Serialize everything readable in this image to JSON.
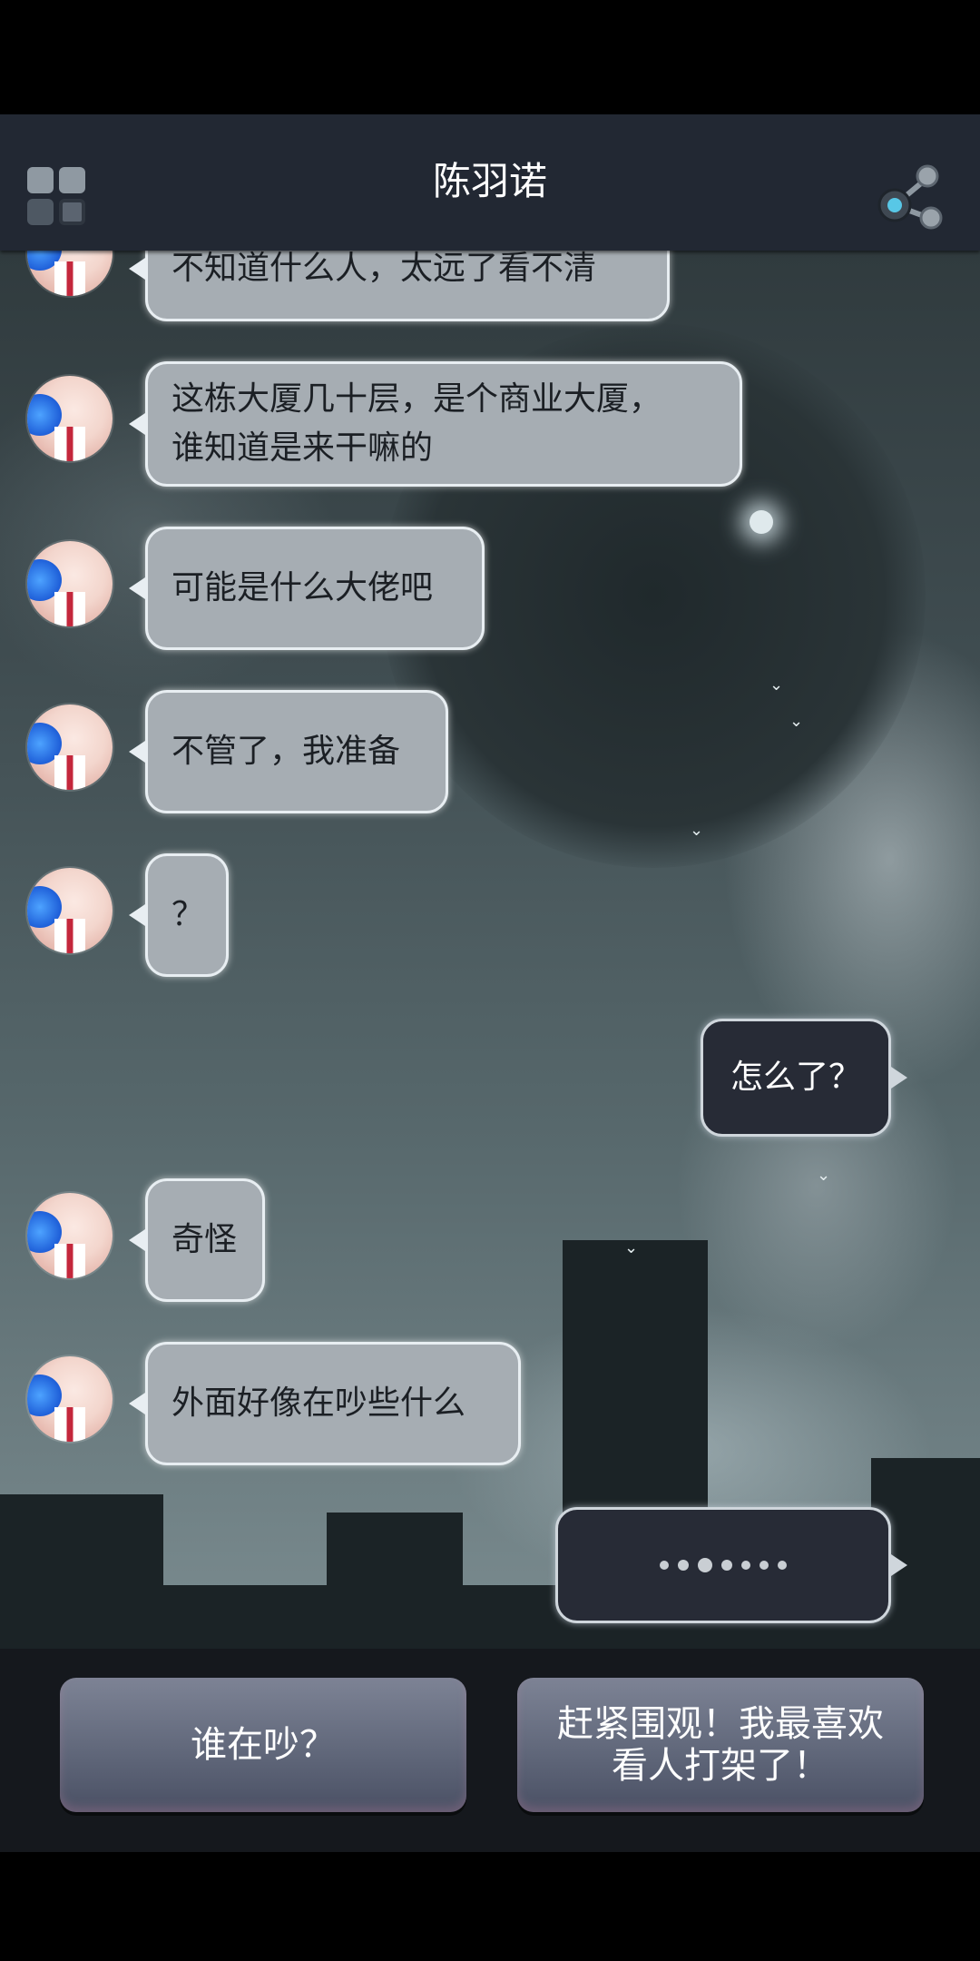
{
  "header": {
    "title": "陈羽诺",
    "menu_icon": "grid-menu-icon",
    "share_icon": "share-icon"
  },
  "messages": [
    {
      "side": "left",
      "text": "不知道什么人，太远了看不清"
    },
    {
      "side": "left",
      "text": "这栋大厦几十层，是个商业大厦，\n谁知道是来干嘛的"
    },
    {
      "side": "left",
      "text": "可能是什么大佬吧"
    },
    {
      "side": "left",
      "text": "不管了，我准备"
    },
    {
      "side": "left",
      "text": "？"
    },
    {
      "side": "right",
      "text": "怎么了？"
    },
    {
      "side": "left",
      "text": "奇怪"
    },
    {
      "side": "left",
      "text": "外面好像在吵些什么"
    },
    {
      "side": "right",
      "text": "",
      "typing": true
    }
  ],
  "choices": [
    {
      "label": "谁在吵？"
    },
    {
      "label": "赶紧围观！我最喜欢\n看人打架了！"
    }
  ],
  "colors": {
    "header_bg": "#222833",
    "left_bubble_bg": "#a6adb3",
    "right_bubble_bg": "#272b36",
    "choice_bg": "#5e6578"
  }
}
